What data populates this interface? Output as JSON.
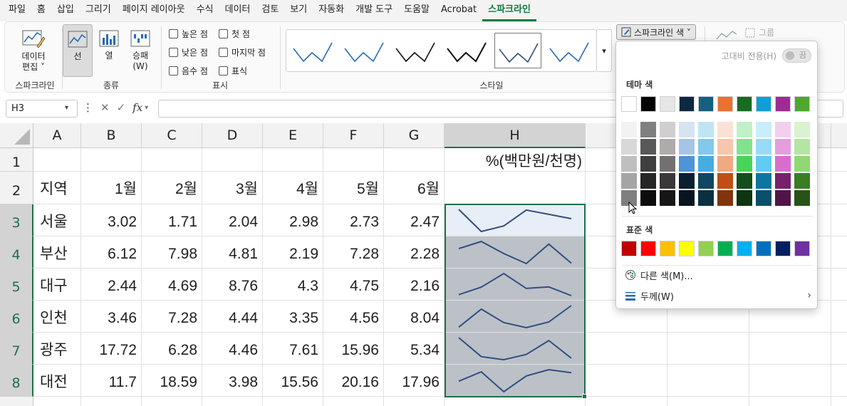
{
  "menu": [
    "파일",
    "홈",
    "삽입",
    "그리기",
    "페이지 레이아웃",
    "수식",
    "데이터",
    "검토",
    "보기",
    "자동화",
    "개발 도구",
    "도움말",
    "Acrobat",
    "스파크라인"
  ],
  "active_menu": "스파크라인",
  "ribbon": {
    "edit_data": {
      "line1": "데이터",
      "line2": "편집 ˅"
    },
    "group_sparkline": "스파크라인",
    "type_buttons": [
      {
        "label": "선",
        "selected": true
      },
      {
        "label": "열"
      },
      {
        "label": "승패",
        "label2": "(W)"
      }
    ],
    "group_type": "종류",
    "show_checkboxes": [
      "높은 점",
      "낮은 점",
      "음수 점",
      "첫 점",
      "마지막 점",
      "표식"
    ],
    "group_show": "표시",
    "group_style": "스타일",
    "sparkline_color": "스파크라인 색 ˅",
    "group_btn": "그룹"
  },
  "formula_bar": {
    "name_box": "H3",
    "fx": "fx"
  },
  "sheet": {
    "columns": [
      "A",
      "B",
      "C",
      "D",
      "E",
      "F",
      "G",
      "H"
    ],
    "rows": [
      "1",
      "2",
      "3",
      "4",
      "5",
      "6",
      "7",
      "8"
    ],
    "h1": "%(백만원/천명)",
    "month_headers": [
      "지역",
      "1월",
      "2월",
      "3월",
      "4월",
      "5월",
      "6월"
    ],
    "data": [
      {
        "region": "서울",
        "values": [
          "3.02",
          "1.71",
          "2.04",
          "2.98",
          "2.73",
          "2.47"
        ]
      },
      {
        "region": "부산",
        "values": [
          "6.12",
          "7.98",
          "4.81",
          "2.19",
          "7.28",
          "2.28"
        ]
      },
      {
        "region": "대구",
        "values": [
          "2.44",
          "4.69",
          "8.76",
          "4.3",
          "4.75",
          "2.16"
        ]
      },
      {
        "region": "인천",
        "values": [
          "3.46",
          "7.28",
          "4.44",
          "3.35",
          "4.56",
          "8.04"
        ]
      },
      {
        "region": "광주",
        "values": [
          "17.72",
          "6.28",
          "4.46",
          "7.61",
          "15.96",
          "5.34"
        ]
      },
      {
        "region": "대전",
        "values": [
          "11.7",
          "18.59",
          "3.98",
          "15.56",
          "20.16",
          "17.96"
        ]
      }
    ]
  },
  "dropdown": {
    "contrast_label": "고대비 전용(H)",
    "contrast_state": "끔",
    "theme_title": "테마 색",
    "theme_top": [
      "#ffffff",
      "#000000",
      "#e7e6e6",
      "#0e2841",
      "#156082",
      "#e97132",
      "#196b24",
      "#0f9ed5",
      "#a02b93",
      "#4ea72e"
    ],
    "theme_shades": [
      [
        "#f2f2f2",
        "#7f7f7f",
        "#d0cece",
        "#d6e3f1",
        "#c1e4f5",
        "#fbe2d5",
        "#c1f0c8",
        "#caedfb",
        "#f2cfee",
        "#d9f2d0"
      ],
      [
        "#d8d8d8",
        "#595959",
        "#aeabab",
        "#a6c5e6",
        "#84c9ec",
        "#f7c6ac",
        "#83e28e",
        "#96dcf7",
        "#e59edd",
        "#b4e5a2"
      ],
      [
        "#bfbfbf",
        "#3f3f3f",
        "#757070",
        "#4d94d8",
        "#47ade0",
        "#f1a983",
        "#47d459",
        "#61cbf4",
        "#d86dcd",
        "#8ed973"
      ],
      [
        "#a5a5a5",
        "#262626",
        "#3a3838",
        "#0b1f31",
        "#104861",
        "#c04f15",
        "#124f1a",
        "#0b76a0",
        "#77206e",
        "#3a7d22"
      ],
      [
        "#7f7f7f",
        "#0c0c0c",
        "#171616",
        "#081420",
        "#0a3041",
        "#80350e",
        "#0c3511",
        "#074f6a",
        "#4f1549",
        "#275317"
      ]
    ],
    "standard_title": "표준 색",
    "standard": [
      "#c00000",
      "#ff0000",
      "#ffc000",
      "#ffff00",
      "#92d050",
      "#00b050",
      "#00b0f0",
      "#0070c0",
      "#002060",
      "#7030a0"
    ],
    "more_colors": "다른 색(M)...",
    "weight": "두께(W)"
  },
  "colors": {
    "accent": "#1e7145",
    "sparkline": "#2f4f7f",
    "sparkline_bg": "#bcc1c8"
  }
}
